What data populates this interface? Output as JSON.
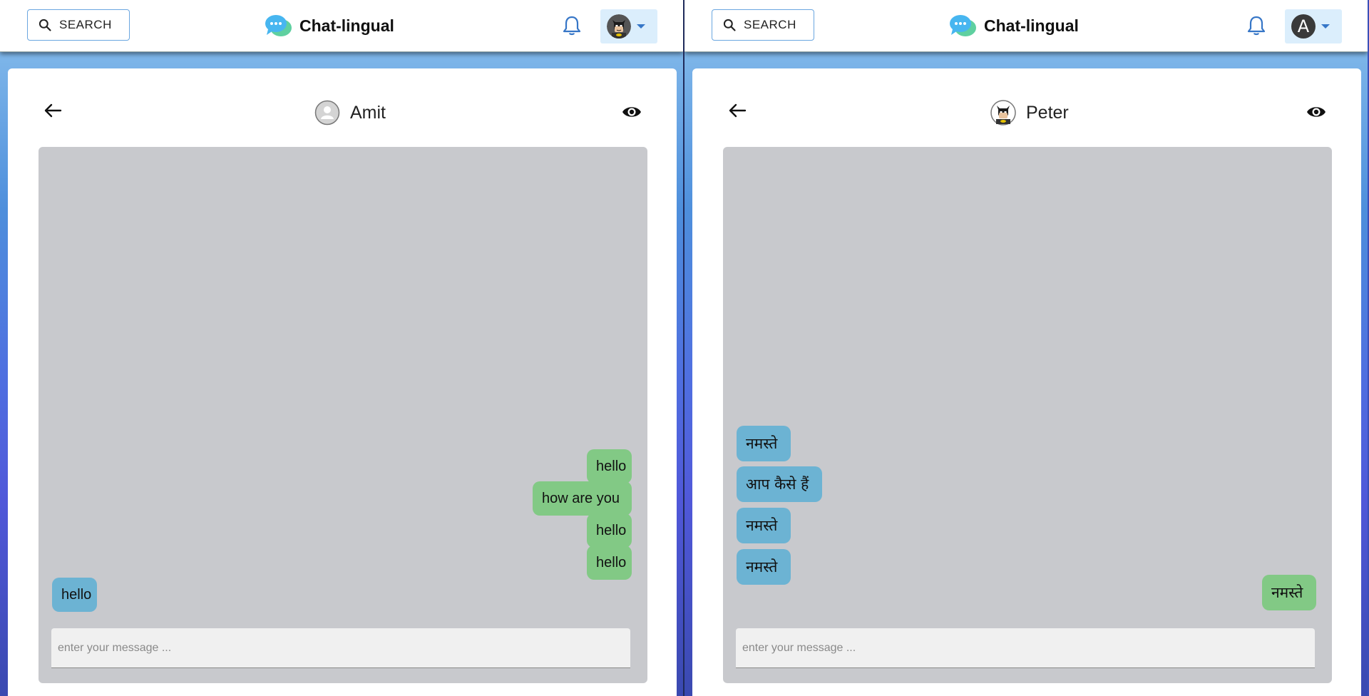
{
  "left_window": {
    "topbar": {
      "search_label": "SEARCH",
      "brand_name": "Chat-lingual",
      "avatar_type": "batman-avatar"
    },
    "chat": {
      "peer_name": "Amit",
      "peer_avatar": "default-user-avatar",
      "messages": [
        {
          "text": "hello",
          "direction": "sent"
        },
        {
          "text": "how are you",
          "direction": "sent"
        },
        {
          "text": "hello",
          "direction": "sent"
        },
        {
          "text": "hello",
          "direction": "sent"
        },
        {
          "text": "hello",
          "direction": "received"
        }
      ],
      "input_placeholder": "enter your message ..."
    }
  },
  "right_window": {
    "topbar": {
      "search_label": "SEARCH",
      "brand_name": "Chat-lingual",
      "avatar_letter": "A"
    },
    "chat": {
      "peer_name": "Peter",
      "peer_avatar": "batman-avatar",
      "messages": [
        {
          "text": "नमस्ते",
          "direction": "received"
        },
        {
          "text": "आप कैसे हैं",
          "direction": "received"
        },
        {
          "text": "नमस्ते",
          "direction": "received"
        },
        {
          "text": "नमस्ते",
          "direction": "received"
        },
        {
          "text": "नमस्ते",
          "direction": "sent"
        }
      ],
      "input_placeholder": "enter your message ..."
    }
  },
  "colors": {
    "sent_bubble": "#82c985",
    "received_bubble": "#6cb3d3",
    "chat_background": "#c8c9cd",
    "accent": "#3676c7"
  },
  "icons": [
    "search-icon",
    "chat-logo-icon",
    "bell-icon",
    "chevron-down-icon",
    "back-arrow-icon",
    "eye-icon"
  ]
}
